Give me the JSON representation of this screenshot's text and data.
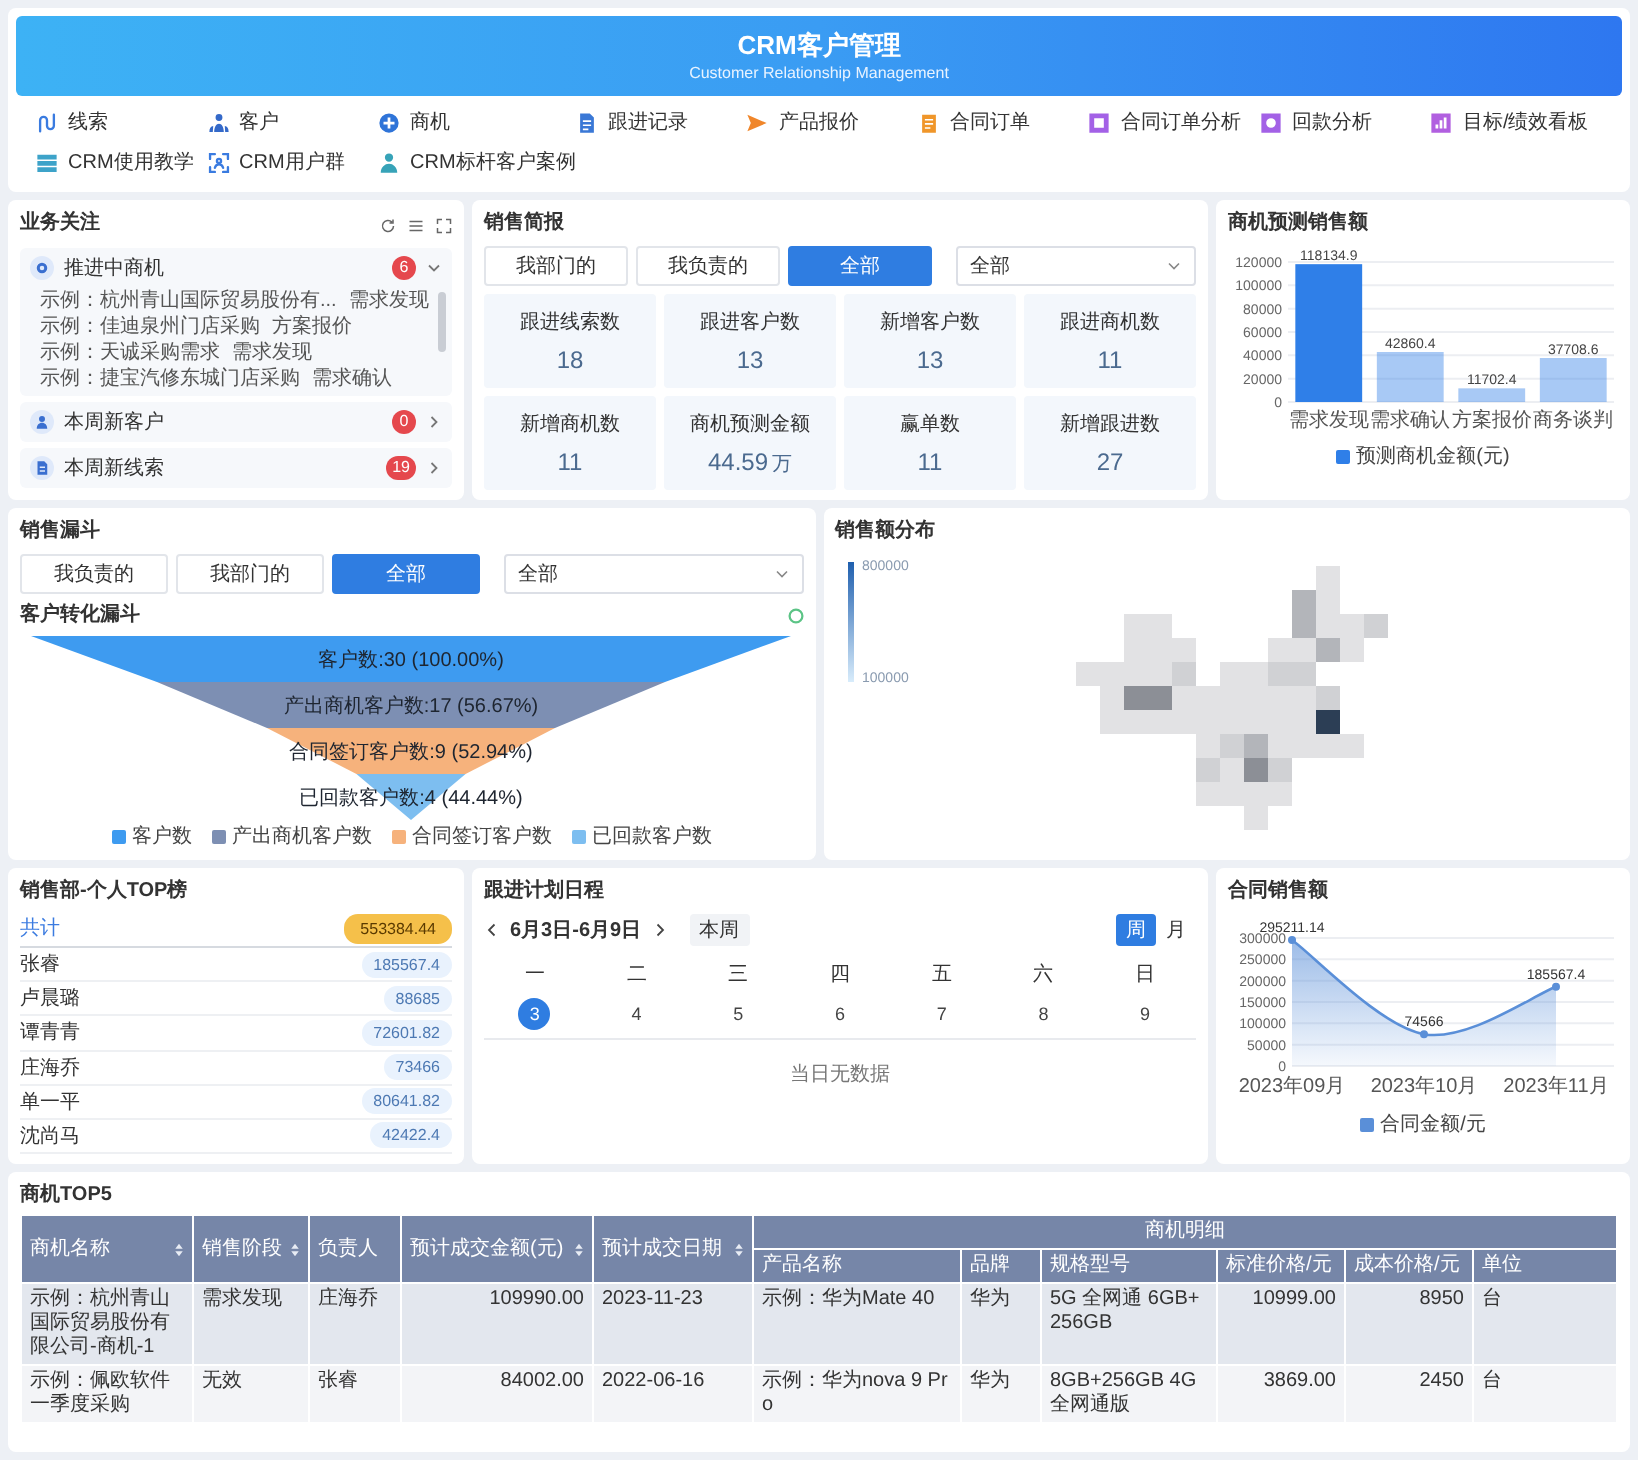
{
  "header": {
    "title": "CRM客户管理",
    "subtitle": "Customer Relationship Management"
  },
  "quick_links": [
    "线索",
    "客户",
    "商机",
    "跟进记录",
    "产品报价",
    "合同订单",
    "合同订单分析",
    "回款分析",
    "目标/绩效看板",
    "CRM使用教学",
    "CRM用户群",
    "CRM标杆客户案例"
  ],
  "focus": {
    "title": "业务关注",
    "groups": [
      {
        "label": "推进中商机",
        "count": "6",
        "expanded": true,
        "items": [
          {
            "name": "示例：杭州青山国际贸易股份有...",
            "stage": "需求发现"
          },
          {
            "name": "示例：佳迪泉州门店采购",
            "stage": "方案报价"
          },
          {
            "name": "示例：天诚采购需求",
            "stage": "需求发现"
          },
          {
            "name": "示例：捷宝汽修东城门店采购",
            "stage": "需求确认"
          }
        ]
      },
      {
        "label": "本周新客户",
        "count": "0",
        "expanded": false
      },
      {
        "label": "本周新线索",
        "count": "19",
        "expanded": false
      }
    ]
  },
  "sales_brief": {
    "title": "销售简报",
    "tabs": [
      {
        "label": "我部门的",
        "selected": false
      },
      {
        "label": "我负责的",
        "selected": false
      },
      {
        "label": "全部",
        "selected": true
      }
    ],
    "scope": "全部",
    "stats": [
      {
        "label": "跟进线索数",
        "value": "18"
      },
      {
        "label": "跟进客户数",
        "value": "13"
      },
      {
        "label": "新增客户数",
        "value": "13"
      },
      {
        "label": "跟进商机数",
        "value": "11"
      },
      {
        "label": "新增商机数",
        "value": "11"
      },
      {
        "label": "商机预测金额",
        "value": "44.59",
        "unit": "万"
      },
      {
        "label": "赢单数",
        "value": "11"
      },
      {
        "label": "新增跟进数",
        "value": "27"
      }
    ]
  },
  "forecast": {
    "title": "商机预测销售额",
    "bars": [
      {
        "highlighted": true
      },
      {
        "highlighted": false
      },
      {
        "highlighted": false
      },
      {
        "highlighted": false
      }
    ],
    "chart_data": {
      "type": "bar",
      "categories": [
        "需求发现",
        "需求确认",
        "方案报价",
        "商务谈判"
      ],
      "series": [
        {
          "name": "预测商机金额(元)",
          "color": "#2f7fe8",
          "values": [
            118134.9,
            42860.4,
            11702.4,
            37708.6
          ]
        }
      ],
      "ylim": [
        0,
        120000
      ],
      "yticks": [
        0,
        20000,
        40000,
        60000,
        80000,
        100000,
        120000
      ],
      "grid": true,
      "data_labels": true
    }
  },
  "funnel": {
    "title": "销售漏斗",
    "tabs": [
      {
        "label": "我负责的",
        "selected": false
      },
      {
        "label": "我部门的",
        "selected": false
      },
      {
        "label": "全部",
        "selected": true
      }
    ],
    "scope": "全部",
    "subtitle": "客户转化漏斗",
    "stages": [
      {
        "label": "客户数:30 (100.00%)",
        "legend": "客户数",
        "color": "#3e9bf0"
      },
      {
        "label": "产出商机客户数:17 (56.67%)",
        "legend": "产出商机客户数",
        "color": "#7d8fb3"
      },
      {
        "label": "合同签订客户数:9 (52.94%)",
        "legend": "合同签订客户数",
        "color": "#f6b27c"
      },
      {
        "label": "已回款客户数:4 (44.44%)",
        "legend": "已回款客户数",
        "color": "#7dbef0"
      }
    ]
  },
  "map": {
    "title": "销售额分布",
    "scale": {
      "max": "800000",
      "min": "100000"
    }
  },
  "top_list": {
    "title": "销售部-个人TOP榜",
    "total": {
      "label": "共计",
      "value": "553384.44"
    },
    "rows": [
      {
        "name": "张睿",
        "value": "185567.4"
      },
      {
        "name": "卢晨璐",
        "value": "88685"
      },
      {
        "name": "谭青青",
        "value": "72601.82"
      },
      {
        "name": "庄海乔",
        "value": "73466"
      },
      {
        "name": "单一平",
        "value": "80641.82"
      },
      {
        "name": "沈尚马",
        "value": "42422.4"
      }
    ]
  },
  "schedule": {
    "title": "跟进计划日程",
    "range": "6月3日-6月9日",
    "this_week": "本周",
    "views": [
      {
        "label": "周",
        "selected": true
      },
      {
        "label": "月",
        "selected": false
      }
    ],
    "days": [
      {
        "weekday": "一",
        "date": "3",
        "selected": true
      },
      {
        "weekday": "二",
        "date": "4",
        "selected": false
      },
      {
        "weekday": "三",
        "date": "5",
        "selected": false
      },
      {
        "weekday": "四",
        "date": "6",
        "selected": false
      },
      {
        "weekday": "五",
        "date": "7",
        "selected": false
      },
      {
        "weekday": "六",
        "date": "8",
        "selected": false
      },
      {
        "weekday": "日",
        "date": "9",
        "selected": false
      }
    ],
    "empty": "当日无数据"
  },
  "contract": {
    "title": "合同销售额",
    "chart_data": {
      "type": "area",
      "x": [
        "2023年09月",
        "2023年10月",
        "2023年11月"
      ],
      "series": [
        {
          "name": "合同金额/元",
          "color": "#5a8fd8",
          "values": [
            295211.14,
            74566,
            185567.4
          ]
        }
      ],
      "ylim": [
        0,
        300000
      ],
      "yticks": [
        0,
        50000,
        100000,
        150000,
        200000,
        250000,
        300000
      ],
      "grid": true,
      "data_labels": true
    }
  },
  "table": {
    "title": "商机TOP5",
    "columns": [
      {
        "label": "商机名称",
        "sortable": true
      },
      {
        "label": "销售阶段",
        "sortable": true
      },
      {
        "label": "负责人",
        "sortable": false
      },
      {
        "label": "预计成交金额(元)",
        "sortable": true
      },
      {
        "label": "预计成交日期",
        "sortable": true
      },
      {
        "label": "商机明细",
        "colspan": 6,
        "children": [
          "产品名称",
          "品牌",
          "规格型号",
          "标准价格/元",
          "成本价格/元",
          "单位"
        ]
      }
    ],
    "rows": [
      [
        "示例：杭州青山国际贸易股份有限公司-商机-1",
        "需求发现",
        "庄海乔",
        "109990.00",
        "2023-11-23",
        "示例：华为Mate 40",
        "华为",
        "5G 全网通 6GB+256GB",
        "10999.00",
        "8950",
        "台"
      ],
      [
        "示例：佩欧软件一季度采购",
        "无效",
        "张睿",
        "84002.00",
        "2022-06-16",
        "示例：华为nova 9 Pro",
        "华为",
        "8GB+256GB 4G 全网通版",
        "3869.00",
        "2450",
        "台"
      ]
    ]
  }
}
